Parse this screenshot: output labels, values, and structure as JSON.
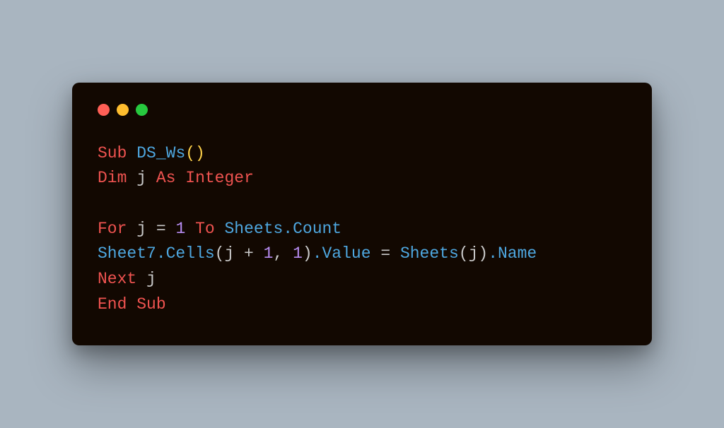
{
  "code": {
    "line1": {
      "t1": "Sub",
      "t2": " ",
      "t3": "DS_Ws",
      "t4": "()"
    },
    "line2": {
      "t1": "Dim",
      "t2": " j ",
      "t3": "As",
      "t4": " ",
      "t5": "Integer"
    },
    "line3": "",
    "line4": {
      "t1": "For",
      "t2": " j = ",
      "t3": "1",
      "t4": " ",
      "t5": "To",
      "t6": " ",
      "t7": "Sheets.Count"
    },
    "line5": {
      "t1": "Sheet7.Cells",
      "t2": "(j + ",
      "t3": "1",
      "t4": ", ",
      "t5": "1",
      "t6": ")",
      "t7": ".Value",
      "t8": " = ",
      "t9": "Sheets",
      "t10": "(j)",
      "t11": ".Name"
    },
    "line6": {
      "t1": "Next",
      "t2": " j"
    },
    "line7": {
      "t1": "End Sub"
    }
  }
}
